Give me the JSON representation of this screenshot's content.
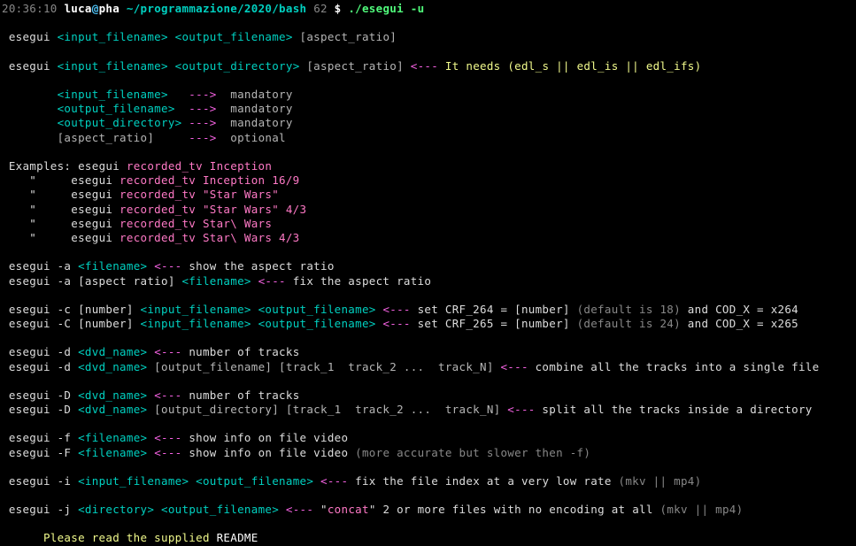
{
  "prompt": {
    "time": "20:36:10",
    "user": "luca",
    "at": "@",
    "host": "pha",
    "tilde": "~",
    "path": "/programmazione/2020/bash",
    "num": "62",
    "dollar": "$",
    "command": "./esegui -u"
  },
  "usage1": {
    "prefix": " esegui ",
    "in": "<input_filename>",
    "sp1": " ",
    "out": "<output_filename>",
    "sp2": " ",
    "asp": "[aspect_ratio]"
  },
  "usage2": {
    "prefix": " esegui ",
    "in": "<input_filename>",
    "sp1": " ",
    "out": "<output_directory>",
    "sp2": " ",
    "asp": "[aspect_ratio]",
    "sp3": " ",
    "arrow": "<---",
    "note": " It needs (edl_s || edl_is || edl_ifs)"
  },
  "params": {
    "p1": {
      "name": "        <input_filename>   ",
      "arrow": "--->",
      "txt": "  mandatory"
    },
    "p2": {
      "name": "        <output_filename>  ",
      "arrow": "--->",
      "txt": "  mandatory"
    },
    "p3": {
      "name": "        <output_directory> ",
      "arrow": "--->",
      "txt": "  mandatory"
    },
    "p4": {
      "name": "        [aspect_ratio]     ",
      "arrow": "--->",
      "txt": "  optional"
    }
  },
  "examples": {
    "label": " Examples: ",
    "e1": {
      "pre": "esegui ",
      "ex": "recorded_tv Inception"
    },
    "e2": {
      "q": "    \"     ",
      "pre": "esegui ",
      "ex": "recorded_tv Inception 16/9"
    },
    "e3": {
      "q": "    \"     ",
      "pre": "esegui ",
      "ex": "recorded_tv \"Star Wars\""
    },
    "e4": {
      "q": "    \"     ",
      "pre": "esegui ",
      "ex": "recorded_tv \"Star Wars\" 4/3"
    },
    "e5": {
      "q": "    \"     ",
      "pre": "esegui ",
      "ex": "recorded_tv Star\\ Wars"
    },
    "e6": {
      "q": "    \"     ",
      "pre": "esegui ",
      "ex": "recorded_tv Star\\ Wars 4/3"
    }
  },
  "opt_a1": {
    "pre": " esegui -a ",
    "fn": "<filename>",
    "sp": " ",
    "arrow": "<---",
    "txt": " show the aspect ratio"
  },
  "opt_a2": {
    "pre": " esegui -a [aspect ratio] ",
    "fn": "<filename>",
    "sp": " ",
    "arrow": "<---",
    "txt": " fix the aspect ratio"
  },
  "opt_c1": {
    "pre": " esegui -c [number] ",
    "in": "<input_filename>",
    "sp1": " ",
    "out": "<output_filename>",
    "sp2": " ",
    "arrow": "<---",
    "txt1": " set CRF_264 = [number] ",
    "def": "(default is 18)",
    "txt2": " and COD_X = x264"
  },
  "opt_c2": {
    "pre": " esegui -C [number] ",
    "in": "<input_filename>",
    "sp1": " ",
    "out": "<output_filename>",
    "sp2": " ",
    "arrow": "<---",
    "txt1": " set CRF_265 = [number] ",
    "def": "(default is 24)",
    "txt2": " and COD_X = x265"
  },
  "opt_d1": {
    "pre": " esegui -d ",
    "dvd": "<dvd_name>",
    "sp": " ",
    "arrow": "<---",
    "txt": " number of tracks"
  },
  "opt_d2": {
    "pre": " esegui -d ",
    "dvd": "<dvd_name>",
    "rest": " [output_filename] [track_1  track_2 ...  track_N] ",
    "arrow": "<---",
    "txt": " combine all the tracks into a single file"
  },
  "opt_D1": {
    "pre": " esegui -D ",
    "dvd": "<dvd_name>",
    "sp": " ",
    "arrow": "<---",
    "txt": " number of tracks"
  },
  "opt_D2": {
    "pre": " esegui -D ",
    "dvd": "<dvd_name>",
    "rest": " [output_directory] [track_1  track_2 ...  track_N] ",
    "arrow": "<---",
    "txt": " split all the tracks inside a directory"
  },
  "opt_f1": {
    "pre": " esegui -f ",
    "fn": "<filename>",
    "sp": " ",
    "arrow": "<---",
    "txt": " show info on file video"
  },
  "opt_f2": {
    "pre": " esegui -F ",
    "fn": "<filename>",
    "sp": " ",
    "arrow": "<---",
    "txt": " show info on file video ",
    "note": "(more accurate but slower then -f)"
  },
  "opt_i": {
    "pre": " esegui -i ",
    "in": "<input_filename>",
    "sp1": " ",
    "out": "<output_filename>",
    "sp2": " ",
    "arrow": "<---",
    "txt": " fix the file index at a very low rate ",
    "note": "(mkv || mp4)"
  },
  "opt_j": {
    "pre": " esegui -j ",
    "dir": "<directory>",
    "sp1": " ",
    "out": "<output_filename>",
    "sp2": " ",
    "arrow": "<---",
    "txt1": " \"",
    "concat": "concat",
    "txt2": "\" 2 or more files with no encoding at all ",
    "note": "(mkv || mp4)"
  },
  "readme": {
    "pre": "      Please read the supplied ",
    "label": "README"
  }
}
